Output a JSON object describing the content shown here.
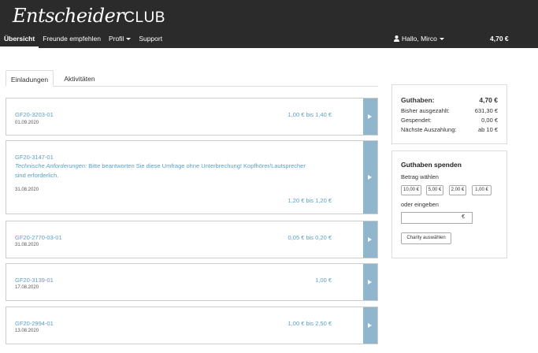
{
  "header": {
    "logo_script": "Entscheider",
    "logo_club": "CLUB",
    "nav": [
      {
        "label": "Übersicht"
      },
      {
        "label": "Freunde empfehlen"
      },
      {
        "label": "Profil"
      },
      {
        "label": "Support"
      }
    ],
    "user_greeting": "Hallo, Mirco",
    "balance": "4,70 €"
  },
  "tabs": [
    {
      "label": "Einladungen"
    },
    {
      "label": "Aktivitäten"
    }
  ],
  "invitations": [
    {
      "id": "GF20-3203-01",
      "date": "01.09.2020",
      "price": "1,00 € bis 1,40 €"
    },
    {
      "id": "GF20-3147-01",
      "date": "31.08.2020",
      "price": "1,20 € bis 1,20 €",
      "desc_label": "Technische Anforderungen:",
      "desc_text": " Bitte beantworten Sie diese Umfrage ohne Unterbrechung! Kopfhörer/Lautsprecher sind erforderlich."
    },
    {
      "id": "GF20-2770-03-01",
      "date": "31.08.2020",
      "price": "0,05 € bis 0,20 €"
    },
    {
      "id": "GF20-3139-01",
      "date": "17.08.2020",
      "price": "1,00 €"
    },
    {
      "id": "GF20-2994-01",
      "date": "13.08.2020",
      "price": "1,00 € bis 2,50 €"
    }
  ],
  "credit": {
    "title": "Guthaben:",
    "amount": "4,70 €",
    "rows": [
      {
        "label": "Bisher ausgezahlt:",
        "value": "631,30 €"
      },
      {
        "label": "Gespendet:",
        "value": "0,00 €"
      },
      {
        "label": "Nächste Auszahlung:",
        "value": "ab 10 €"
      }
    ]
  },
  "donate": {
    "title": "Guthaben spenden",
    "choose_label": "Betrag wählen",
    "amounts": [
      "10,00 €",
      "5,00 €",
      "2,00 €",
      "1,00 €"
    ],
    "or_label": "oder eingeben",
    "input_unit": "€",
    "charity_button": "Charity auswählen"
  },
  "colors": {
    "topbar": "#2b2b2b",
    "accent": "#5aa0c8",
    "card_bar": "#8fb6cc"
  }
}
